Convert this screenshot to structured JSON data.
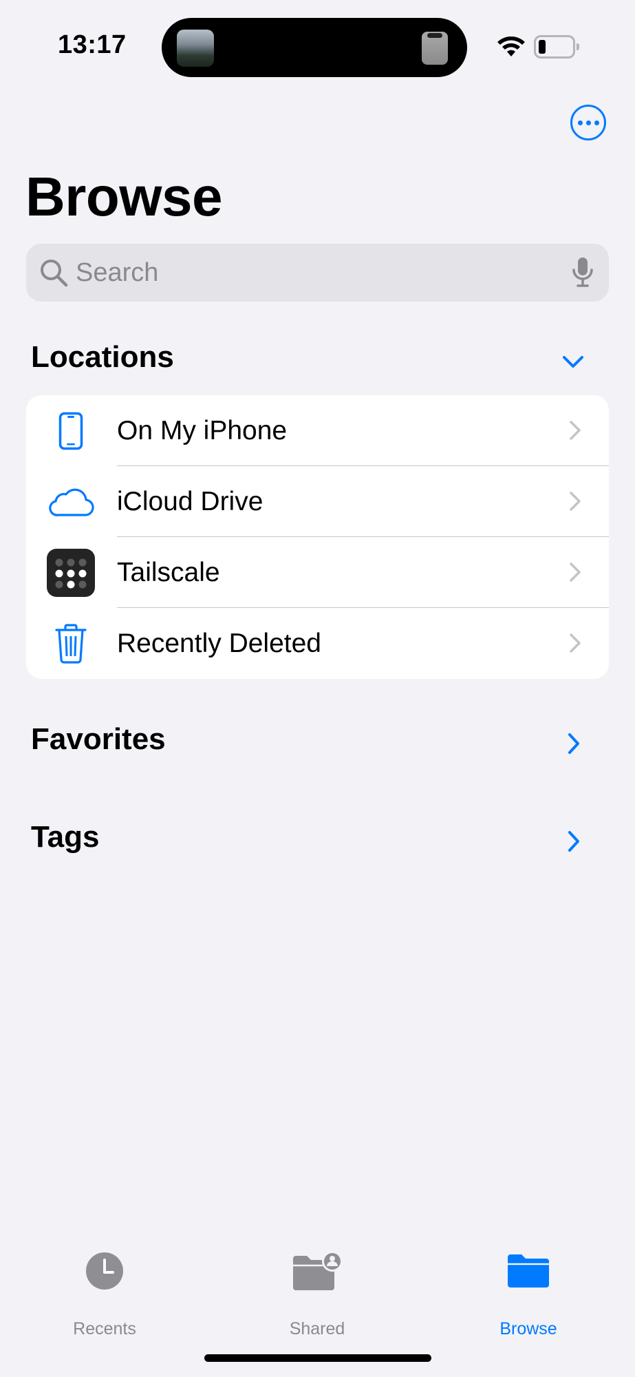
{
  "status_bar": {
    "time": "13:17"
  },
  "header": {
    "more_icon": "ellipsis-circle-icon",
    "title": "Browse"
  },
  "search": {
    "placeholder": "Search",
    "value": "",
    "icon": "magnifying-glass-icon",
    "mic_icon": "microphone-icon"
  },
  "locations": {
    "title": "Locations",
    "toggle_icon": "chevron-down-icon",
    "items": [
      {
        "label": "On My iPhone",
        "icon": "iphone-icon"
      },
      {
        "label": "iCloud Drive",
        "icon": "cloud-icon"
      },
      {
        "label": "Tailscale",
        "icon": "tailscale-app-icon"
      },
      {
        "label": "Recently Deleted",
        "icon": "trash-icon"
      }
    ]
  },
  "favorites": {
    "title": "Favorites",
    "icon": "chevron-right-icon"
  },
  "tags": {
    "title": "Tags",
    "icon": "chevron-right-icon"
  },
  "tab_bar": {
    "tabs": [
      {
        "label": "Recents",
        "icon": "clock-icon",
        "active": false
      },
      {
        "label": "Shared",
        "icon": "shared-folder-icon",
        "active": false
      },
      {
        "label": "Browse",
        "icon": "folder-icon",
        "active": true
      }
    ]
  },
  "colors": {
    "accent": "#007aff",
    "background": "#f2f2f7",
    "secondary_text": "#8a8a8e"
  }
}
